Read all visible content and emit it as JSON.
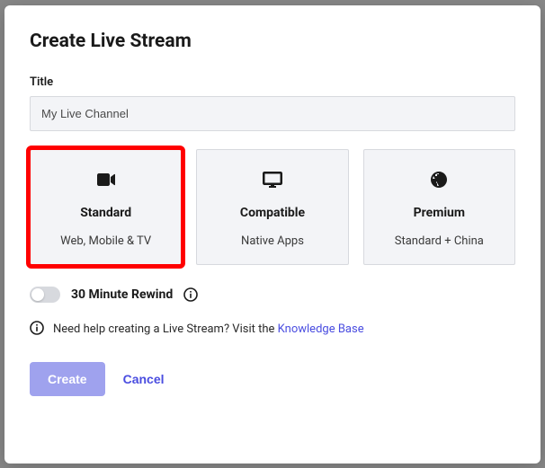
{
  "modal": {
    "title": "Create Live Stream"
  },
  "form": {
    "title_label": "Title",
    "title_value": "My Live Channel"
  },
  "options": [
    {
      "icon": "video-camera-icon",
      "title": "Standard",
      "subtitle": "Web, Mobile & TV",
      "selected": true
    },
    {
      "icon": "monitor-icon",
      "title": "Compatible",
      "subtitle": "Native Apps",
      "selected": false
    },
    {
      "icon": "globe-icon",
      "title": "Premium",
      "subtitle": "Standard + China",
      "selected": false
    }
  ],
  "rewind": {
    "label": "30 Minute Rewind",
    "enabled": false
  },
  "help": {
    "text_prefix": "Need help creating a Live Stream? Visit the ",
    "link_text": "Knowledge Base"
  },
  "buttons": {
    "create": "Create",
    "cancel": "Cancel"
  }
}
